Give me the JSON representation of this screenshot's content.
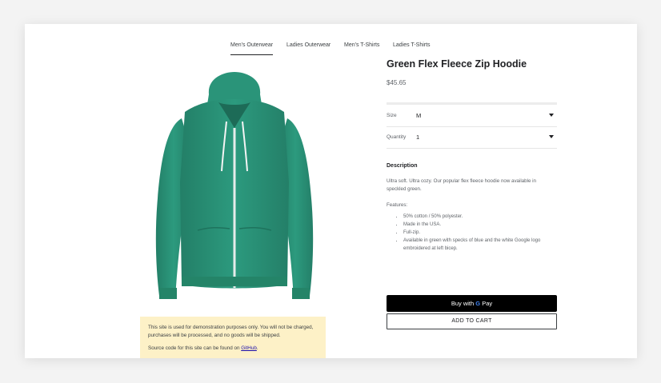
{
  "nav": {
    "tabs": [
      {
        "label": "Men's Outerwear",
        "active": true
      },
      {
        "label": "Ladies Outerwear",
        "active": false
      },
      {
        "label": "Men's T-Shirts",
        "active": false
      },
      {
        "label": "Ladies T-Shirts",
        "active": false
      }
    ]
  },
  "product": {
    "title": "Green Flex Fleece Zip Hoodie",
    "price": "$45.65",
    "image_color": "#2a9479",
    "size": {
      "label": "Size",
      "value": "M"
    },
    "quantity": {
      "label": "Quantity",
      "value": "1"
    },
    "description_heading": "Description",
    "description": "Ultra soft. Ultra cozy. Our popular flex fleece hoodie now available in speckled green.",
    "features_label": "Features:",
    "features": [
      "50% cotton / 50% polyester.",
      "Made in the USA.",
      "Full-zip.",
      "Available in green with specks of blue and the white Google logo embroidered at left bicep."
    ]
  },
  "actions": {
    "gpay_prefix": "Buy with",
    "gpay_suffix": "Pay",
    "add_to_cart": "ADD TO CART"
  },
  "notice": {
    "text": "This site is used for demonstration purposes only. You will not be charged, purchases will be processed, and no goods will be shipped.",
    "source_prefix": "Source code for this site can be found on",
    "source_link": "GitHub",
    "source_suffix": "."
  }
}
